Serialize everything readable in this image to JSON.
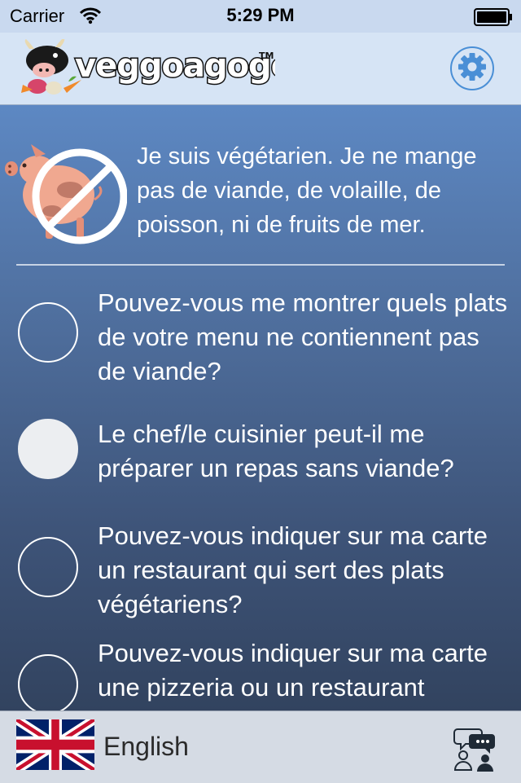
{
  "status_bar": {
    "carrier": "Carrier",
    "time": "5:29 PM",
    "icons": [
      "wifi-icon",
      "battery-icon"
    ]
  },
  "header": {
    "logo_text": "veggoagogo",
    "trademark": "TM",
    "settings_icon": "gear-icon",
    "accent_color": "#4a8fd6"
  },
  "intro": {
    "icon": "no-pork-icon",
    "text": "Je suis végétarien. Je ne mange pas de viande, de volaille, de poisson, ni de fruits de mer."
  },
  "questions": [
    {
      "text": "Pouvez-vous me montrer quels plats de votre menu ne contiennent pas de viande?",
      "selected": false
    },
    {
      "text": "Le chef/le cuisinier peut-il me préparer un repas sans viande?",
      "selected": true
    },
    {
      "text": "Pouvez-vous indiquer sur ma carte un restaurant qui sert des plats végétariens?",
      "selected": false
    },
    {
      "text": "Pouvez-vous indiquer sur ma carte une pizzeria ou un restaurant italien?",
      "selected": false
    }
  ],
  "bottom_bar": {
    "flag_icon": "uk-flag-icon",
    "language": "English",
    "chat_icon": "chat-users-icon"
  }
}
